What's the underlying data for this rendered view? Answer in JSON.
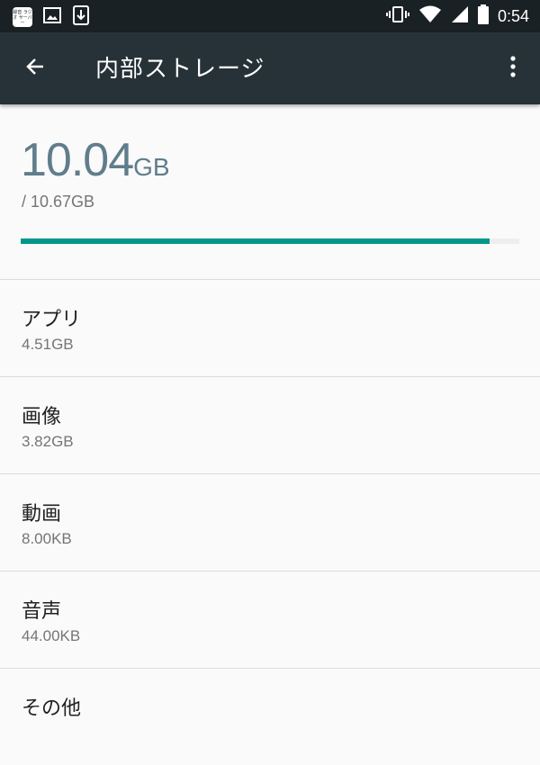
{
  "status_bar": {
    "time": "0:54",
    "app_icon_text": "録音 ラジオ サーバー",
    "left_icons": [
      "radio-recorder-app-icon",
      "image-icon",
      "download-icon"
    ],
    "right_icons": [
      "vibrate-icon",
      "wifi-icon",
      "cell-signal-icon",
      "battery-icon"
    ]
  },
  "app_bar": {
    "title": "内部ストレージ",
    "back_icon": "arrow-back-icon",
    "menu_icon": "more-vert-icon"
  },
  "summary": {
    "used_number": "10.04",
    "used_unit": "GB",
    "total": "/ 10.67GB",
    "used_fraction": 0.941,
    "bar_color": "#00968a"
  },
  "categories": [
    {
      "label": "アプリ",
      "size": "4.51GB"
    },
    {
      "label": "画像",
      "size": "3.82GB"
    },
    {
      "label": "動画",
      "size": "8.00KB"
    },
    {
      "label": "音声",
      "size": "44.00KB"
    },
    {
      "label": "その他",
      "size": ""
    }
  ],
  "colors": {
    "status_bar_bg": "#1a2125",
    "app_bar_bg": "#263238",
    "accent": "#00968a",
    "used_text": "#607d8b"
  }
}
